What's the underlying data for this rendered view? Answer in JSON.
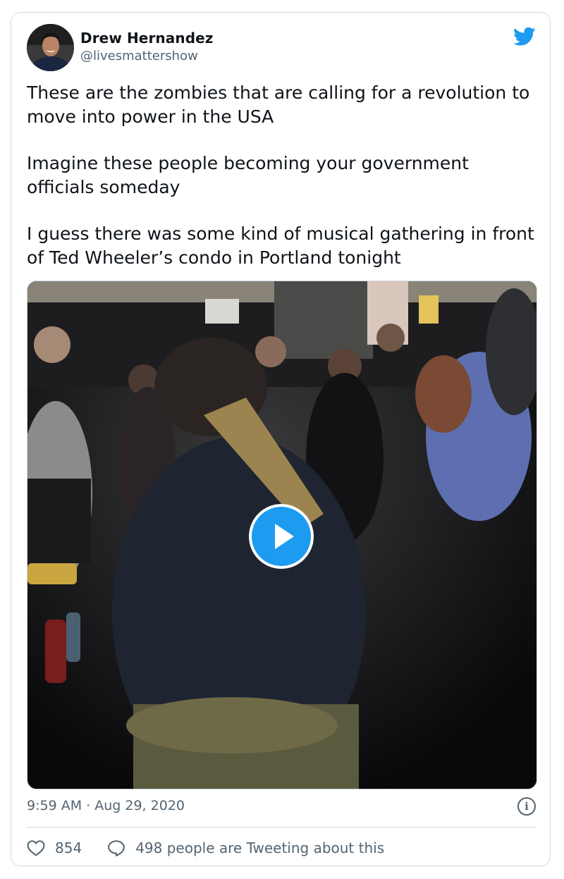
{
  "author": {
    "name": "Drew Hernandez",
    "handle": "@livesmattershow"
  },
  "tweet": {
    "paragraphs": [
      "These are the zombies that are calling for a revolution to move into power in the USA",
      "Imagine these people becoming your government officials someday",
      "I guess there was some kind of musical gathering in front of Ted Wheeler’s condo in Portland tonight"
    ]
  },
  "media": {
    "type": "video"
  },
  "meta": {
    "timestamp": "9:59 AM · Aug 29, 2020",
    "info_glyph": "i"
  },
  "actions": {
    "likes": "854",
    "conversation": "498 people are Tweeting about this"
  },
  "icons": {
    "brand": "twitter-bird-icon",
    "like": "heart-icon",
    "reply": "speech-bubble-icon",
    "play": "play-icon",
    "info": "info-icon"
  },
  "colors": {
    "brand_blue": "#1d9bf0",
    "text": "#0f1419",
    "secondary": "#536471",
    "border": "#cfd9de"
  }
}
